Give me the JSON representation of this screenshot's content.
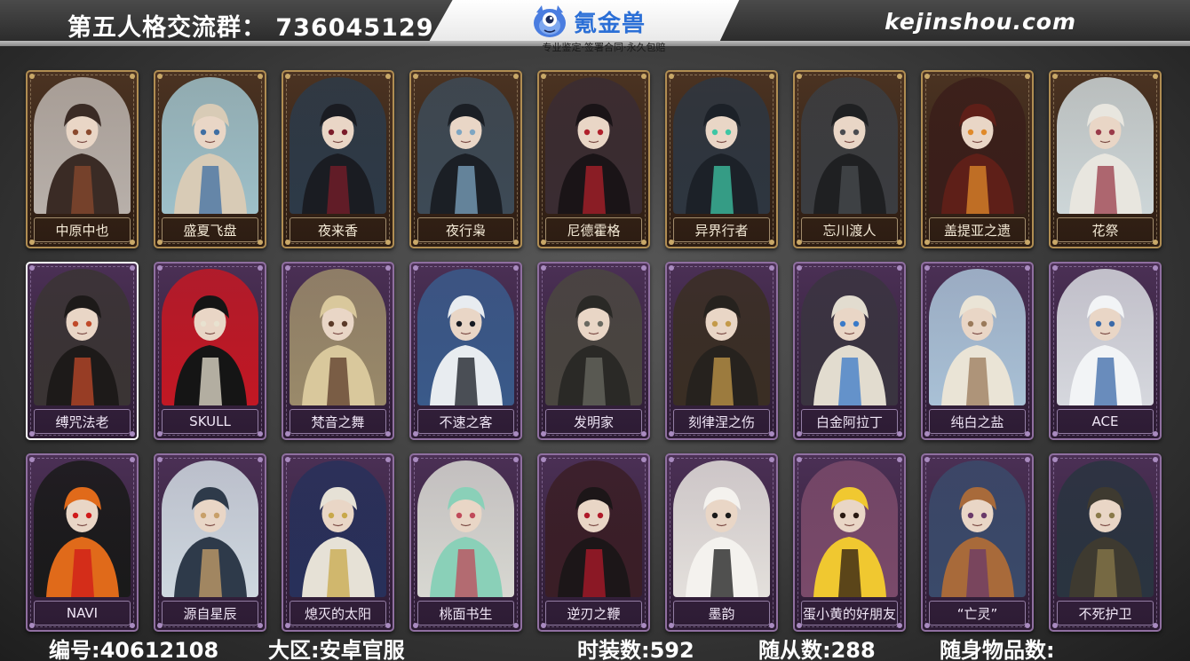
{
  "header": {
    "group_text": "第五人格交流群： 736045129",
    "site": "kejinshou.com",
    "logo_name": "氪金兽",
    "logo_tagline": "专业鉴定·签署合同·永久包赔",
    "logo_icon": "mascot-icon"
  },
  "cards": [
    {
      "name": "中原中也",
      "frame": "gold",
      "bg": "#b8b0aa",
      "figure": "#3a2b25",
      "accent": "#8a4a2e"
    },
    {
      "name": "盛夏飞盘",
      "frame": "gold",
      "bg": "#9ec0c9",
      "figure": "#d8cbb6",
      "accent": "#3f6fa3"
    },
    {
      "name": "夜来香",
      "frame": "gold",
      "bg": "#2d3a48",
      "figure": "#1a1c22",
      "accent": "#7a1c2a"
    },
    {
      "name": "夜行枭",
      "frame": "gold",
      "bg": "#3d4a56",
      "figure": "#1b1f25",
      "accent": "#7ea6c2"
    },
    {
      "name": "尼德霍格",
      "frame": "gold",
      "bg": "#3a2c32",
      "figure": "#1a1417",
      "accent": "#b0202b"
    },
    {
      "name": "异界行者",
      "frame": "gold",
      "bg": "#2e3640",
      "figure": "#1c2128",
      "accent": "#3ec6a4"
    },
    {
      "name": "忘川渡人",
      "frame": "gold",
      "bg": "#3b3d41",
      "figure": "#1f2022",
      "accent": "#4a4c50"
    },
    {
      "name": "盖提亚之遗",
      "frame": "gold",
      "bg": "#3a1e1a",
      "figure": "#5e1f18",
      "accent": "#e08a2a"
    },
    {
      "name": "花祭",
      "frame": "gold",
      "bg": "#cdd6d8",
      "figure": "#e8e6df",
      "accent": "#9a3b4a"
    },
    {
      "name": "缚咒法老",
      "frame": "purple",
      "border_white": true,
      "bg": "#3a3434",
      "figure": "#1d1a19",
      "accent": "#c04a2a"
    },
    {
      "name": "SKULL",
      "frame": "purple",
      "bg": "#c21824",
      "figure": "#151515",
      "accent": "#e8e2d0"
    },
    {
      "name": "梵音之舞",
      "frame": "purple",
      "bg": "#9a8a6a",
      "figure": "#d9c89c",
      "accent": "#5a3a28"
    },
    {
      "name": "不速之客",
      "frame": "purple",
      "bg": "#3a5a8a",
      "figure": "#e8ecf0",
      "accent": "#161a22"
    },
    {
      "name": "发明家",
      "frame": "purple",
      "bg": "#4a4640",
      "figure": "#2a2926",
      "accent": "#6a6a62"
    },
    {
      "name": "刻律涅之伤",
      "frame": "purple",
      "bg": "#3a2e24",
      "figure": "#26221e",
      "accent": "#c49a4a"
    },
    {
      "name": "白金阿拉丁",
      "frame": "purple",
      "bg": "#3a3440",
      "figure": "#e2dccf",
      "accent": "#3a7ac8"
    },
    {
      "name": "纯白之盐",
      "frame": "purple",
      "bg": "#a9c1d6",
      "figure": "#eae4d6",
      "accent": "#9a7a5a"
    },
    {
      "name": "ACE",
      "frame": "purple",
      "bg": "#d6d8de",
      "figure": "#f2f4f6",
      "accent": "#3b6aa8"
    },
    {
      "name": "NAVI",
      "frame": "purple",
      "bg": "#1a1a1a",
      "figure": "#e06a1a",
      "accent": "#d01a1a"
    },
    {
      "name": "源自星辰",
      "frame": "purple",
      "bg": "#cfd8e0",
      "figure": "#2e3a4a",
      "accent": "#c8a06a"
    },
    {
      "name": "熄灭的太阳",
      "frame": "purple",
      "bg": "#28305a",
      "figure": "#e6e1d6",
      "accent": "#c8a84a"
    },
    {
      "name": "桃面书生",
      "frame": "purple",
      "bg": "#d8d8d2",
      "figure": "#8ad0b8",
      "accent": "#c04a5a"
    },
    {
      "name": "逆刃之鞭",
      "frame": "purple",
      "bg": "#3a1e26",
      "figure": "#1c1618",
      "accent": "#b01a2a"
    },
    {
      "name": "墨韵",
      "frame": "purple",
      "bg": "#e4e0dc",
      "figure": "#f4f2ee",
      "accent": "#1a1a1a"
    },
    {
      "name": "蛋小黄的好朋友",
      "frame": "purple",
      "bg": "#7a4a6a",
      "figure": "#f0c830",
      "accent": "#2a1a12"
    },
    {
      "name": "“亡灵”",
      "frame": "purple",
      "bg": "#3a4a6a",
      "figure": "#a86a3a",
      "accent": "#6a3a6a"
    },
    {
      "name": "不死护卫",
      "frame": "purple",
      "bg": "#2a3440",
      "figure": "#3e3a30",
      "accent": "#8a7a4a"
    }
  ],
  "footer": {
    "id": "编号:40612108",
    "region": "大区:安卓官服",
    "outfits": "时装数:592",
    "pets": "随从数:288",
    "items": "随身物品数:"
  }
}
